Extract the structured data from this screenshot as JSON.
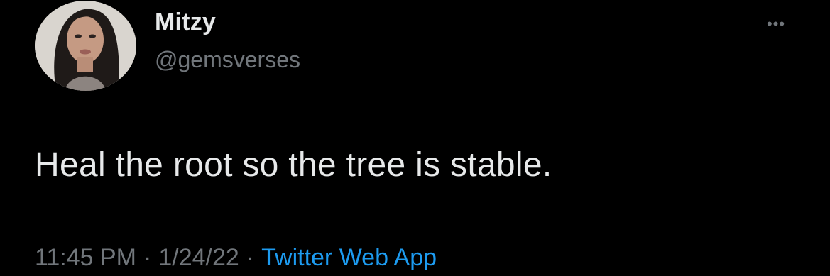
{
  "tweet": {
    "display_name": "Mitzy",
    "handle": "@gemsverses",
    "text": "Heal the root so the tree is stable.",
    "time": "11:45 PM",
    "date": "1/24/22",
    "separator": "·",
    "source": "Twitter Web App"
  },
  "icons": {
    "more": "more-horizontal-icon"
  },
  "colors": {
    "background": "#000000",
    "primary_text": "#e7e9ea",
    "secondary_text": "#71767b",
    "link": "#1d9bf0"
  }
}
